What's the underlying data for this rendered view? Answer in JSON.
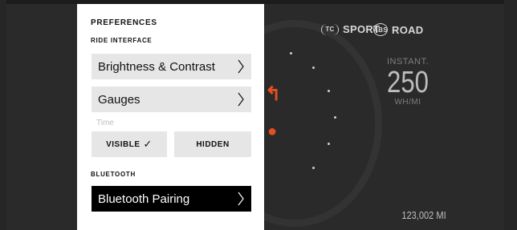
{
  "panel": {
    "title": "PREFERENCES",
    "ride_section": "RIDE INTERFACE",
    "items": [
      {
        "label": "Brightness & Contrast"
      },
      {
        "label": "Gauges"
      }
    ],
    "time_label": "Time",
    "time_options": [
      {
        "label": "VISIBLE",
        "selected": true
      },
      {
        "label": "HIDDEN",
        "selected": false
      }
    ],
    "bluetooth_section": "BLUETOOTH",
    "bluetooth_item": {
      "label": "Bluetooth Pairing"
    }
  },
  "dashboard": {
    "tc_icon": "tc-icon",
    "tc_icon_text": "TC",
    "mode": "SPORT",
    "abs_icon": "abs-icon",
    "abs_icon_text": "ABS",
    "ride_mode": "ROAD",
    "instant_label": "INSTANT.",
    "instant_value": "250",
    "instant_unit": "WH/MI",
    "odometer": "123,002 MI"
  },
  "colors": {
    "accent": "#e5511e",
    "panel_bg": "#ffffff",
    "row_bg": "#e6e6e6",
    "dash_bg": "#2a2a2a"
  }
}
